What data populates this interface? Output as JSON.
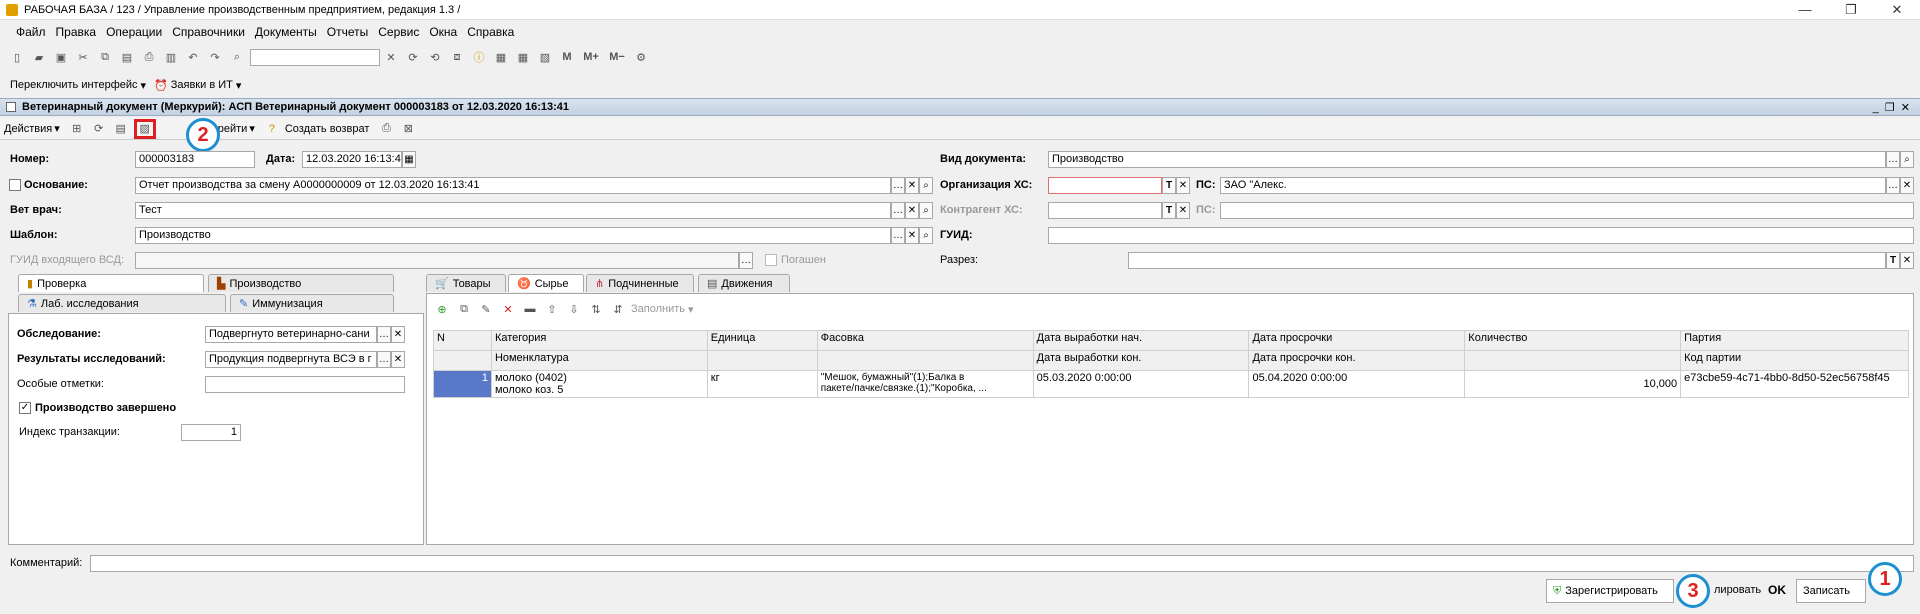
{
  "window": {
    "title": "РАБОЧАЯ БАЗА / 123 /  Управление производственным предприятием, редакция 1.3 /"
  },
  "menu": [
    "Файл",
    "Правка",
    "Операции",
    "Справочники",
    "Документы",
    "Отчеты",
    "Сервис",
    "Окна",
    "Справка"
  ],
  "toolbar2": {
    "switch_interface": "Переключить интерфейс",
    "requests": "Заявки в ИТ"
  },
  "doc": {
    "title": "Ветеринарный документ (Меркурий): АСП Ветеринарный документ 000003183 от 12.03.2020 16:13:41",
    "actions": "Действия",
    "goto": "Перейти",
    "create_return": "Создать возврат"
  },
  "form": {
    "number_label": "Номер:",
    "number": "000003183",
    "date_label": "Дата:",
    "date": "12.03.2020 16:13:4",
    "doc_type_label": "Вид документа:",
    "doc_type": "Производство",
    "basis_label": "Основание:",
    "basis": "Отчет производства за смену А0000000009 от 12.03.2020 16:13:41",
    "org_label": "Организация ХС:",
    "ps_label": "ПС:",
    "org_ps": "ЗАО \"Алекс.",
    "vet_label": "Вет врач:",
    "vet": "Тест",
    "contractor_label": "Контрагент ХС:",
    "ps2_label": "ПС:",
    "template_label": "Шаблон:",
    "template": "Производство",
    "guid_label": "ГУИД:",
    "guid_in_label": "ГУИД входящего ВСД:",
    "repaid_label": "Погашен",
    "section_label": "Разрез:"
  },
  "left_tabs": {
    "check": "Проверка",
    "production": "Производство",
    "lab": "Лаб. исследования",
    "immun": "Иммунизация"
  },
  "left_panel": {
    "survey_label": "Обследование:",
    "survey": "Подвергнуто ветеринарно-сани",
    "results_label": "Результаты исследований:",
    "results": "Продукция подвергнута ВСЭ в г",
    "notes_label": "Особые отметки:",
    "done_label": "Производство завершено",
    "tx_label": "Индекс транзакции:",
    "tx": "1"
  },
  "right_tabs": {
    "goods": "Товары",
    "raw": "Сырье",
    "subordinate": "Подчиненные",
    "moves": "Движения"
  },
  "grid_toolbar": {
    "fill": "Заполнить"
  },
  "grid": {
    "headers_top": [
      "N",
      "Категория",
      "Единица",
      "Фасовка",
      "Дата выработки нач.",
      "Дата просрочки",
      "Количество",
      "Партия"
    ],
    "headers_bottom": [
      "",
      "Номенклатура",
      "",
      "",
      "Дата выработки кон.",
      "Дата просрочки кон.",
      "",
      "Код партии"
    ],
    "row": {
      "n": "1",
      "category": "молоко (0402)",
      "nomenclature": "молоко коз. 5",
      "unit": "кг",
      "pack": "\"Мешок, бумажный\"(1);Балка в пакете/пачке/связке.(1);\"Коробка, ...",
      "date_start": "05.03.2020 0:00:00",
      "date_exp": "05.04.2020 0:00:00",
      "qty": "10,000",
      "party": "e73cbe59-4c71-4bb0-8d50-52ec56758f45"
    }
  },
  "footer": {
    "comment_label": "Комментарий:",
    "register": "Зарегистрировать",
    "print_partial": "лировать",
    "ok": "OK",
    "save": "Записать"
  },
  "callouts": {
    "one": "1",
    "two": "2",
    "three": "3"
  },
  "colors": {
    "callout_border": "#e02020",
    "circle_border": "#1e90d0",
    "selected_cell": "#5a78c8"
  }
}
